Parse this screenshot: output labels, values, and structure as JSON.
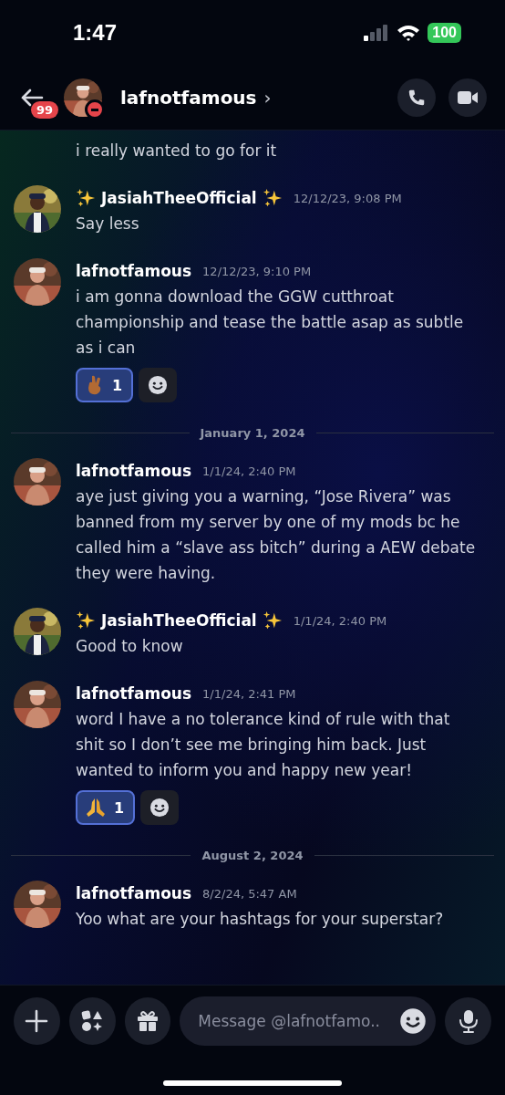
{
  "status_bar": {
    "time": "1:47",
    "battery": "100"
  },
  "header": {
    "unread_badge": "99",
    "title": "lafnotfamous",
    "chevron": "›"
  },
  "messages": [
    {
      "kind": "continuation",
      "lines": "i really wanted to go for it"
    },
    {
      "kind": "message",
      "author": "JasiahTheeOfficial",
      "decorated": true,
      "time": "12/12/23, 9:08 PM",
      "text": "Say less"
    },
    {
      "kind": "message",
      "author": "lafnotfamous",
      "decorated": false,
      "time": "12/12/23, 9:10 PM",
      "text": "i am gonna download the GGW cutthroat championship and tease the battle asap as subtle as i can",
      "reactions": [
        {
          "kind": "fingers",
          "count": "1",
          "selected": true
        }
      ]
    },
    {
      "kind": "divider",
      "date": "January 1, 2024"
    },
    {
      "kind": "message",
      "author": "lafnotfamous",
      "decorated": false,
      "time": "1/1/24, 2:40 PM",
      "text": "aye just giving you a warning, “Jose Rivera” was banned from my server by one of my mods bc he called him a “slave ass bitch” during a AEW debate they were having."
    },
    {
      "kind": "message",
      "author": "JasiahTheeOfficial",
      "decorated": true,
      "time": "1/1/24, 2:40 PM",
      "text": "Good to know"
    },
    {
      "kind": "message",
      "author": "lafnotfamous",
      "decorated": false,
      "time": "1/1/24, 2:41 PM",
      "text": "word I have a no tolerance kind of rule with that shit so I don’t see me bringing him back. Just wanted to inform you and happy new year!",
      "reactions": [
        {
          "kind": "pray",
          "count": "1",
          "selected": true
        }
      ]
    },
    {
      "kind": "divider",
      "date": "August 2, 2024"
    },
    {
      "kind": "message",
      "author": "lafnotfamous",
      "decorated": false,
      "time": "8/2/24, 5:47 AM",
      "text": "Yoo what are your hashtags for your superstar?"
    }
  ],
  "composer": {
    "placeholder": "Message @lafnotfamo.."
  }
}
